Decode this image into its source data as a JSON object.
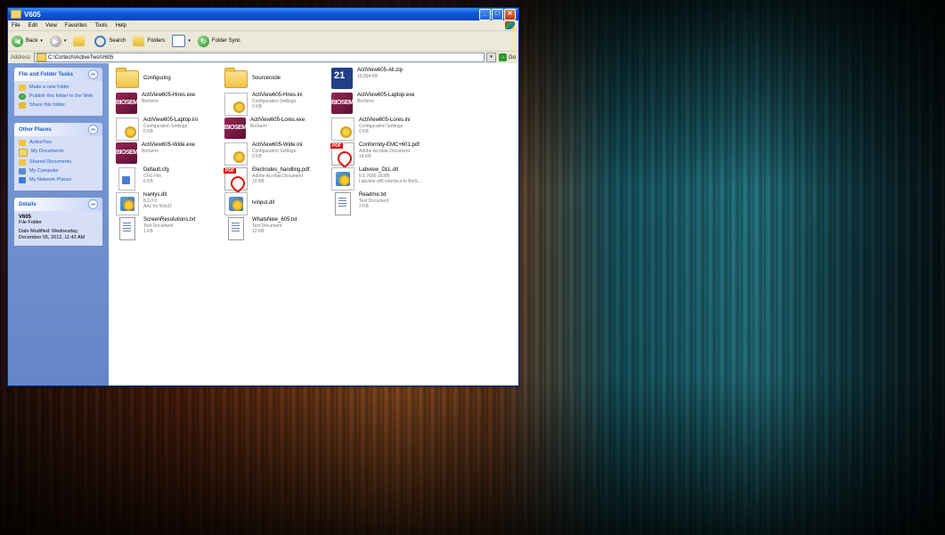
{
  "window": {
    "title": "V605",
    "menu": [
      "File",
      "Edit",
      "View",
      "Favorites",
      "Tools",
      "Help"
    ],
    "toolbar": {
      "back": "Back",
      "search": "Search",
      "folders": "Folders",
      "folder_sync": "Folder Sync"
    },
    "address": {
      "label": "Address",
      "path": "C:\\Cortech\\ActiveTwo\\V605",
      "go": "Go"
    }
  },
  "sidebar": {
    "tasks": {
      "title": "File and Folder Tasks",
      "items": [
        "Make a new folder",
        "Publish this folder to the Web",
        "Share this folder"
      ]
    },
    "places": {
      "title": "Other Places",
      "items": [
        "ActiveTwo",
        "My Documents",
        "Shared Documents",
        "My Computer",
        "My Network Places"
      ]
    },
    "details": {
      "title": "Details",
      "name": "V605",
      "type": "File Folder",
      "modified": "Date Modified: Wednesday, December 05, 2012, 11:42 AM"
    }
  },
  "files": [
    {
      "name": "Configuring",
      "line1": "",
      "line2": "",
      "icon": "folder-icon"
    },
    {
      "name": "Sourcecode",
      "line1": "",
      "line2": "",
      "icon": "folder-icon"
    },
    {
      "name": "ActiView605-All.zip",
      "line1": "10,894 KB",
      "line2": "",
      "icon": "zip-icon"
    },
    {
      "name": "ActiView605-Hires.exe",
      "line1": "BioSemi",
      "line2": "",
      "icon": "biosemi-icon"
    },
    {
      "name": "ActiView605-Hires.ini",
      "line1": "Configuration Settings",
      "line2": "0 KB",
      "icon": "ini-icon"
    },
    {
      "name": "ActiView605-Laptop.exe",
      "line1": "BioSemi",
      "line2": "",
      "icon": "biosemi-icon"
    },
    {
      "name": "ActiView605-Laptop.ini",
      "line1": "Configuration Settings",
      "line2": "0 KB",
      "icon": "ini-icon"
    },
    {
      "name": "ActiView605-Lores.exe",
      "line1": "BioSemi",
      "line2": "",
      "icon": "biosemi-icon"
    },
    {
      "name": "ActiView605-Lores.ini",
      "line1": "Configuration Settings",
      "line2": "0 KB",
      "icon": "ini-icon"
    },
    {
      "name": "ActiView605-Wide.exe",
      "line1": "BioSemi",
      "line2": "",
      "icon": "biosemi-icon"
    },
    {
      "name": "ActiView605-Wide.ini",
      "line1": "Configuration Settings",
      "line2": "0 KB",
      "icon": "ini-icon"
    },
    {
      "name": "Conformity-EMC+601.pdf",
      "line1": "Adobe Acrobat Document",
      "line2": "14 KB",
      "icon": "pdf-icon"
    },
    {
      "name": "Default.cfg",
      "line1": "CFG File",
      "line2": "6 KB",
      "icon": "cfg-icon"
    },
    {
      "name": "Electrodes_handling.pdf",
      "line1": "Adobe Acrobat Document",
      "line2": "19 KB",
      "icon": "pdf-icon"
    },
    {
      "name": "Labview_DLL.dll",
      "line1": "6.1.7600.16385",
      "line2": "Labview x86 interface to BioS...",
      "icon": "dll-icon"
    },
    {
      "name": "lvanlys.dll",
      "line1": "8.2.0.0",
      "line2": "AAL for Win32",
      "icon": "dll-icon"
    },
    {
      "name": "lvinput.dll",
      "line1": "",
      "line2": "",
      "icon": "dll-icon"
    },
    {
      "name": "Readme.txt",
      "line1": "Text Document",
      "line2": "3 KB",
      "icon": "txt-icon"
    },
    {
      "name": "ScreenResolutions.txt",
      "line1": "Text Document",
      "line2": "1 KB",
      "icon": "txt-icon"
    },
    {
      "name": "WhatsNew_605.txt",
      "line1": "Text Document",
      "line2": "12 KB",
      "icon": "txt-icon"
    }
  ]
}
